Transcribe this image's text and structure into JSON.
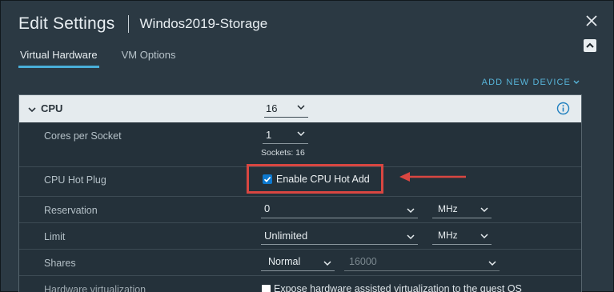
{
  "dialog": {
    "title": "Edit Settings",
    "vm_name": "Windos2019-Storage"
  },
  "tabs": [
    {
      "label": "Virtual Hardware",
      "active": true
    },
    {
      "label": "VM Options",
      "active": false
    }
  ],
  "add_device": {
    "label": "ADD NEW DEVICE"
  },
  "cpu": {
    "label": "CPU",
    "value": "16",
    "cores_per_socket": {
      "label": "Cores per Socket",
      "value": "1",
      "sockets_text": "Sockets: 16"
    },
    "hot_plug": {
      "label": "CPU Hot Plug",
      "checkbox_label": "Enable CPU Hot Add",
      "checked": true
    },
    "reservation": {
      "label": "Reservation",
      "value": "0",
      "unit": "MHz"
    },
    "limit": {
      "label": "Limit",
      "value": "Unlimited",
      "unit": "MHz"
    },
    "shares": {
      "label": "Shares",
      "level": "Normal",
      "value": "16000"
    },
    "hw_virtualization": {
      "label": "Hardware virtualization",
      "checkbox_label": "Expose hardware assisted virtualization to the guest OS",
      "checked": false
    }
  },
  "colors": {
    "accent": "#49afd9",
    "highlight": "#d94641",
    "checkbox": "#0d79cf",
    "background": "#2b3943"
  },
  "icons": [
    "close-icon",
    "collapse-up-icon",
    "chevron-down-icon",
    "info-icon",
    "checkmark-icon",
    "arrow-left-icon"
  ]
}
